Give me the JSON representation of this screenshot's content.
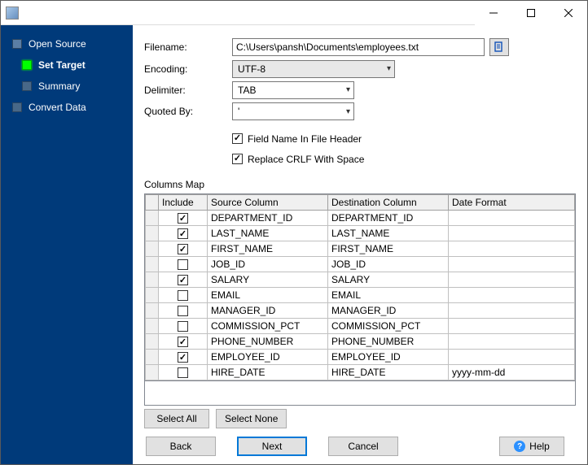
{
  "window": {
    "title": ""
  },
  "sidebar": {
    "items": [
      {
        "label": "Open Source"
      },
      {
        "label": "Set Target"
      },
      {
        "label": "Summary"
      },
      {
        "label": "Convert Data"
      }
    ]
  },
  "form": {
    "filename_label": "Filename:",
    "filename_value": "C:\\Users\\pansh\\Documents\\employees.txt",
    "encoding_label": "Encoding:",
    "encoding_value": "UTF-8",
    "delimiter_label": "Delimiter:",
    "delimiter_value": "TAB",
    "quoted_label": "Quoted By:",
    "quoted_value": "'",
    "chk_fieldname_label": "Field Name In File Header",
    "chk_fieldname_checked": true,
    "chk_replace_label": "Replace CRLF With Space",
    "chk_replace_checked": true
  },
  "columns_map": {
    "title": "Columns Map",
    "headers": {
      "include": "Include",
      "source": "Source Column",
      "dest": "Destination Column",
      "datefmt": "Date Format"
    },
    "rows": [
      {
        "include": true,
        "source": "DEPARTMENT_ID",
        "dest": "DEPARTMENT_ID",
        "datefmt": ""
      },
      {
        "include": true,
        "source": "LAST_NAME",
        "dest": "LAST_NAME",
        "datefmt": ""
      },
      {
        "include": true,
        "source": "FIRST_NAME",
        "dest": "FIRST_NAME",
        "datefmt": ""
      },
      {
        "include": false,
        "source": "JOB_ID",
        "dest": "JOB_ID",
        "datefmt": ""
      },
      {
        "include": true,
        "source": "SALARY",
        "dest": "SALARY",
        "datefmt": ""
      },
      {
        "include": false,
        "source": "EMAIL",
        "dest": "EMAIL",
        "datefmt": ""
      },
      {
        "include": false,
        "source": "MANAGER_ID",
        "dest": "MANAGER_ID",
        "datefmt": ""
      },
      {
        "include": false,
        "source": "COMMISSION_PCT",
        "dest": "COMMISSION_PCT",
        "datefmt": ""
      },
      {
        "include": true,
        "source": "PHONE_NUMBER",
        "dest": "PHONE_NUMBER",
        "datefmt": ""
      },
      {
        "include": true,
        "source": "EMPLOYEE_ID",
        "dest": "EMPLOYEE_ID",
        "datefmt": ""
      },
      {
        "include": false,
        "source": "HIRE_DATE",
        "dest": "HIRE_DATE",
        "datefmt": "yyyy-mm-dd"
      }
    ]
  },
  "buttons": {
    "select_all": "Select All",
    "select_none": "Select None",
    "back": "Back",
    "next": "Next",
    "cancel": "Cancel",
    "help": "Help"
  }
}
